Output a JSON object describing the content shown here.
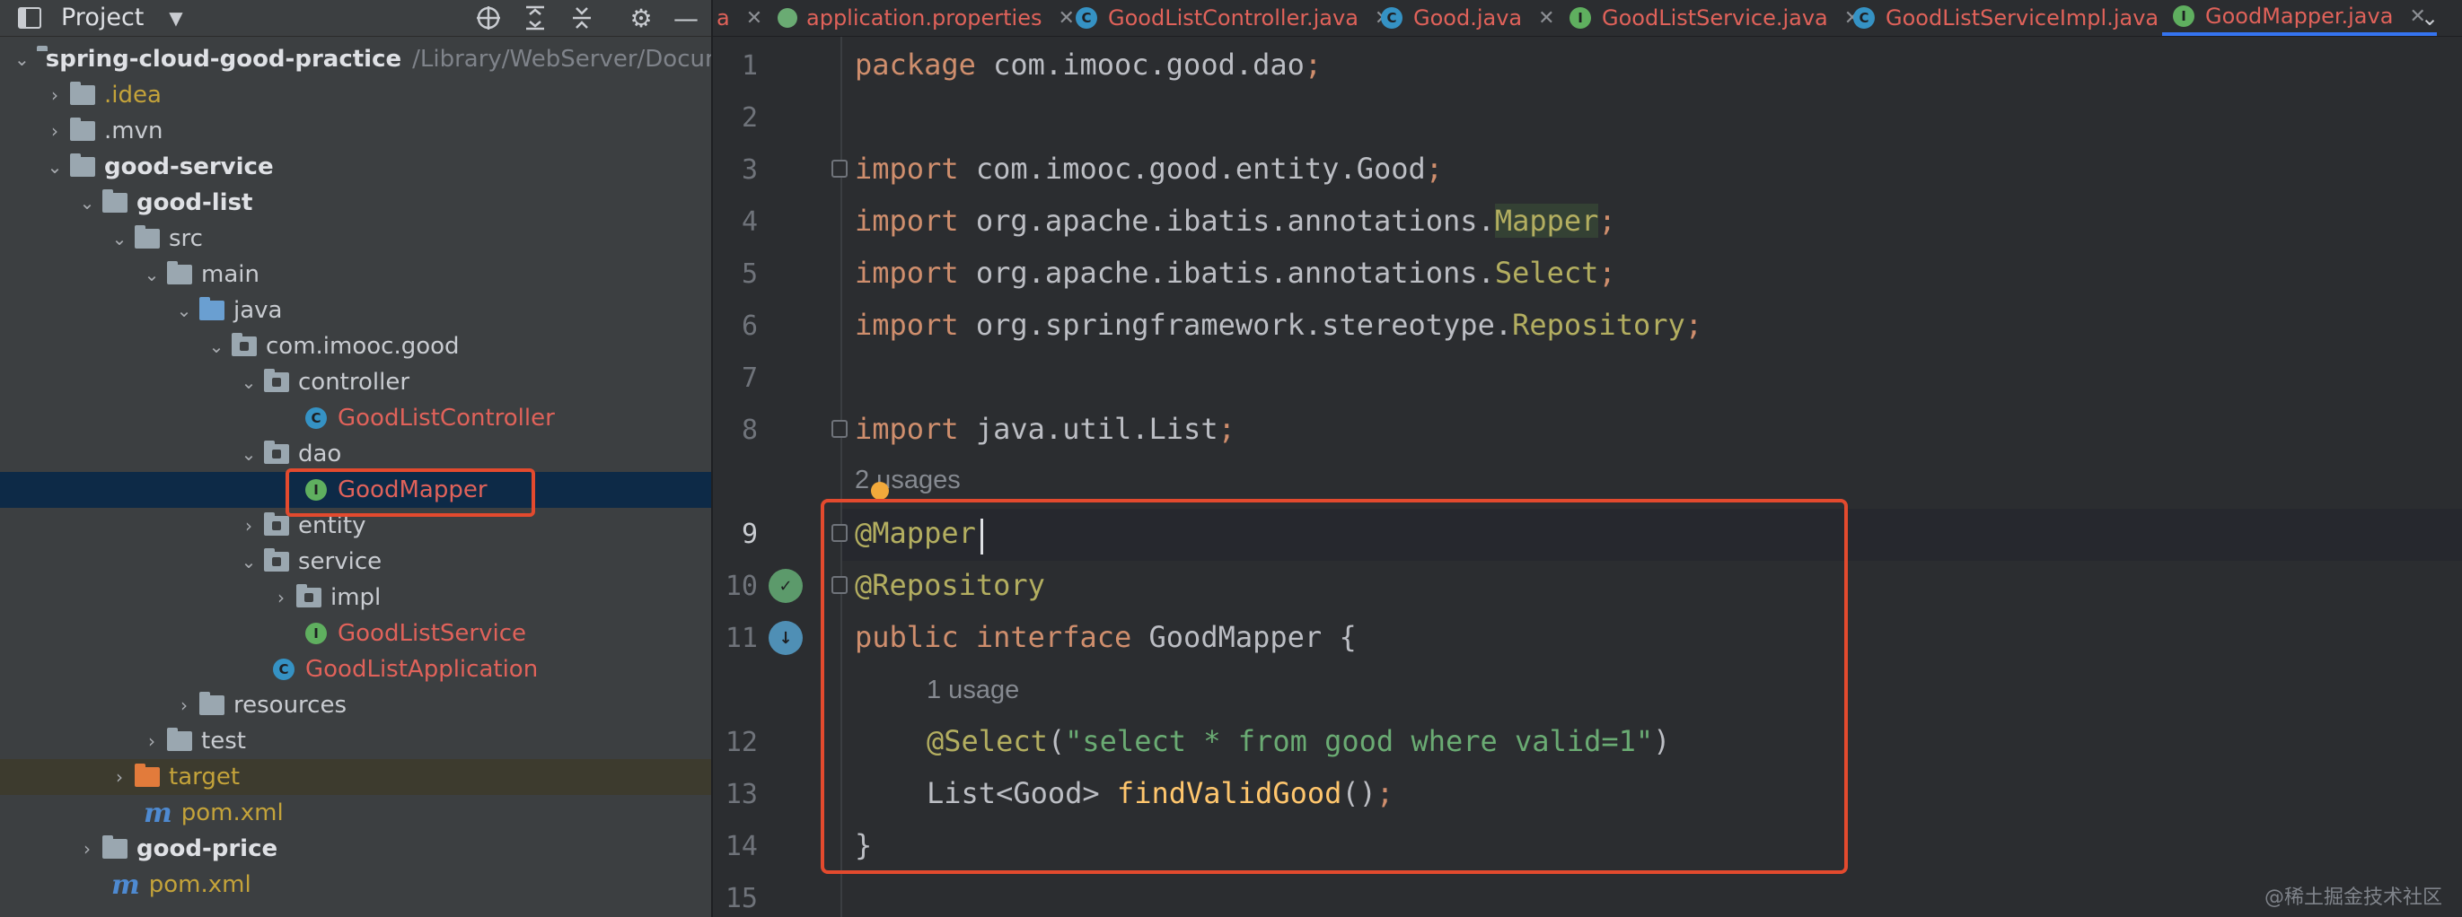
{
  "project_panel": {
    "title": "Project",
    "tree": [
      {
        "label": "spring-cloud-good-practice",
        "path": "/Library/WebServer/Docum"
      },
      {
        "label": ".idea"
      },
      {
        "label": ".mvn"
      },
      {
        "label": "good-service"
      },
      {
        "label": "good-list"
      },
      {
        "label": "src"
      },
      {
        "label": "main"
      },
      {
        "label": "java"
      },
      {
        "label": "com.imooc.good"
      },
      {
        "label": "controller"
      },
      {
        "label": "GoodListController",
        "badge": "C"
      },
      {
        "label": "dao"
      },
      {
        "label": "GoodMapper",
        "badge": "I"
      },
      {
        "label": "entity"
      },
      {
        "label": "service"
      },
      {
        "label": "impl"
      },
      {
        "label": "GoodListService",
        "badge": "I"
      },
      {
        "label": "GoodListApplication",
        "badge": "C"
      },
      {
        "label": "resources"
      },
      {
        "label": "test"
      },
      {
        "label": "target"
      },
      {
        "label": "pom.xml",
        "badge": "m"
      },
      {
        "label": "good-price"
      },
      {
        "label": "pom.xml",
        "badge": "m"
      }
    ]
  },
  "tabs": [
    {
      "label": "a"
    },
    {
      "label": "application.properties"
    },
    {
      "label": "GoodListController.java",
      "badge": "C"
    },
    {
      "label": "Good.java",
      "badge": "C"
    },
    {
      "label": "GoodListService.java",
      "badge": "I"
    },
    {
      "label": "GoodListServiceImpl.java",
      "badge": "C"
    },
    {
      "label": "GoodMapper.java",
      "badge": "I"
    }
  ],
  "editor": {
    "line_numbers": [
      "1",
      "2",
      "3",
      "4",
      "5",
      "6",
      "7",
      "8",
      "9",
      "10",
      "11",
      "12",
      "13",
      "14",
      "15"
    ],
    "code": {
      "l1_kw": "package",
      "l1_rest": " com.imooc.good.dao",
      "l3_kw": "import",
      "l3_rest": " com.imooc.good.entity.Good",
      "l4_kw": "import",
      "l4_pre": " org.apache.ibatis.annotations.",
      "l4_name": "Mapper",
      "l5_kw": "import",
      "l5_pre": " org.apache.ibatis.annotations.",
      "l5_name": "Select",
      "l6_kw": "import",
      "l6_pre": " org.springframework.stereotype.",
      "l6_name": "Repository",
      "l8_kw": "import",
      "l8_rest": " java.util.List",
      "semicolon": ";",
      "usages_2": "2 usages",
      "l9": "@Mapper",
      "l10": "@Repository",
      "l11_kw1": "public",
      "l11_kw2": "interface",
      "l11_rest": " GoodMapper {",
      "usage_1": "1 usage",
      "l12_ann": "@Select",
      "l12_open": "(",
      "l12_str": "\"select * from good where valid=1\"",
      "l12_close": ")",
      "l13_type": "List<Good> ",
      "l13_fn": "findValidGood",
      "l13_rest": "()",
      "l14": "}"
    },
    "gutter_icons": {
      "l10": "implemented-icon",
      "l11": "implemented-icon"
    }
  },
  "watermark": "@稀土掘金技术社区",
  "colors": {
    "highlight_box": "#e34a2e",
    "selection": "#0d2a47"
  }
}
